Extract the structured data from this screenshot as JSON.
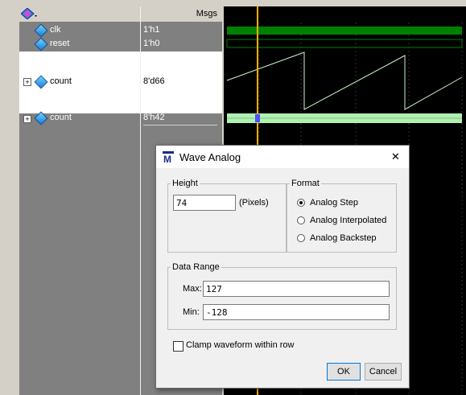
{
  "columns": {
    "msgs": "Msgs"
  },
  "signals": [
    {
      "name": "clk",
      "value": "1'h1"
    },
    {
      "name": "reset",
      "value": "1'h0"
    },
    {
      "name": "count",
      "value": "8'd66"
    },
    {
      "name": "count",
      "value": "8'h42"
    }
  ],
  "colors": {
    "clk_wave": "#008000",
    "cursor": "#ffb000",
    "count_wave": "#c8f5c8",
    "bus_wave": "#b0f0b0"
  },
  "dialog": {
    "title": "Wave Analog",
    "height_group": "Height",
    "height_value": "74",
    "height_unit": "(Pixels)",
    "format_group": "Format",
    "format_options": [
      "Analog Step",
      "Analog Interpolated",
      "Analog Backstep"
    ],
    "format_selected": "Analog Step",
    "range_group": "Data Range",
    "max_label": "Max:",
    "max_value": "127",
    "min_label": "Min:",
    "min_value": "-128",
    "clamp_label": "Clamp waveform within row",
    "clamp_checked": false,
    "ok_label": "OK",
    "cancel_label": "Cancel",
    "close_glyph": "✕"
  }
}
